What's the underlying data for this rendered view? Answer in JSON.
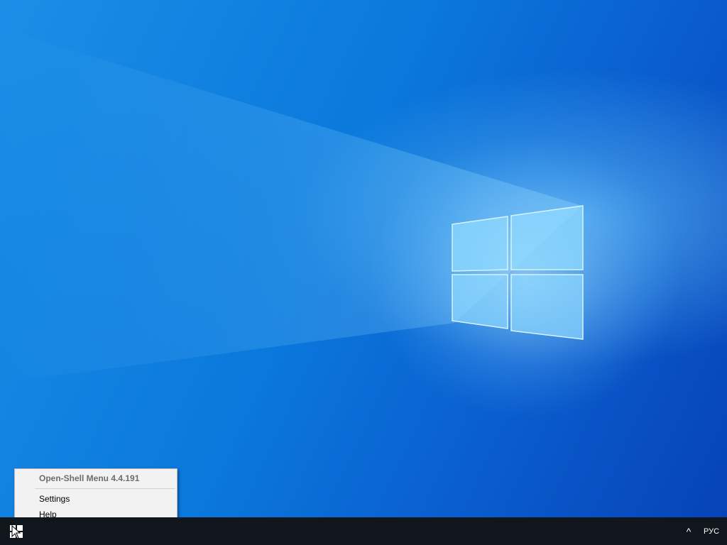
{
  "desktop": {
    "wallpaper": "Windows 10 light wallpaper",
    "colors": {
      "background_light": "#1b8fe6",
      "background_dark": "#0643b8",
      "logo_glow": "#78d2ff"
    }
  },
  "taskbar": {
    "start_icon": "windows-logo-icon",
    "tray_chevron": "^",
    "language": "РУС",
    "background_color": "#10161c"
  },
  "context_menu": {
    "header": "Open-Shell Menu 4.4.191",
    "items": [
      {
        "label": "Settings"
      },
      {
        "label": "Help"
      }
    ]
  }
}
